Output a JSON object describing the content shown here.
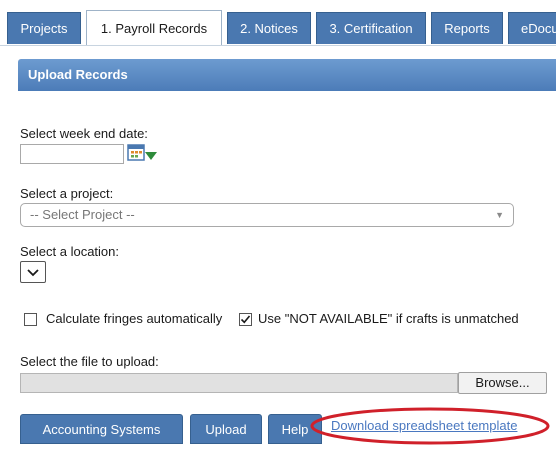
{
  "tabs": [
    {
      "label": "Projects",
      "active": false
    },
    {
      "label": "1. Payroll Records",
      "active": true
    },
    {
      "label": "2. Notices",
      "active": false
    },
    {
      "label": "3. Certification",
      "active": false
    },
    {
      "label": "Reports",
      "active": false
    },
    {
      "label": "eDocu",
      "active": false
    }
  ],
  "panel": {
    "title": "Upload Records"
  },
  "form": {
    "week_end_label": "Select week end date:",
    "week_end_value": "",
    "project_label": "Select a project:",
    "project_selected": "-- Select Project --",
    "location_label": "Select a location:",
    "calc_fringes_label": "Calculate fringes automatically",
    "calc_fringes_checked": false,
    "not_available_label": "Use \"NOT AVAILABLE\" if crafts is unmatched",
    "not_available_checked": true,
    "file_label": "Select the file to upload:",
    "browse_label": "Browse..."
  },
  "buttons": {
    "accounting": "Accounting Systems",
    "upload": "Upload",
    "help": "Help",
    "download_link": "Download spreadsheet template"
  },
  "colors": {
    "tab_bg": "#4a78b0",
    "header_gradient_top": "#6d9bd0",
    "link": "#4a78c0",
    "highlight": "#d0202a"
  },
  "icons": {
    "calendar": "calendar-icon",
    "dropdown": "chevron-down-icon",
    "checkmark": "check-icon"
  }
}
